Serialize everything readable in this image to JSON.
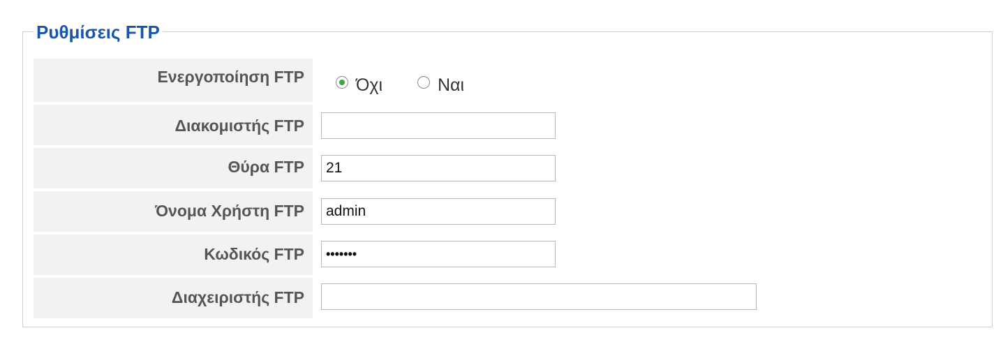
{
  "section": {
    "title": "Ρυθμίσεις FTP"
  },
  "ftp_enable": {
    "label": "Ενεργοποίηση FTP",
    "options": [
      "Όχι",
      "Ναι"
    ],
    "selected": "Όχι"
  },
  "ftp_server": {
    "label": "Διακομιστής FTP",
    "value": ""
  },
  "ftp_port": {
    "label": "Θύρα FTP",
    "value": "21"
  },
  "ftp_username": {
    "label": "Όνομα Χρήστη FTP",
    "value": "admin"
  },
  "ftp_password": {
    "label": "Κωδικός FTP",
    "value": "•••••••"
  },
  "ftp_manager": {
    "label": "Διαχειριστής FTP",
    "value": ""
  },
  "colors": {
    "accent": "#1a56a8",
    "radio_selected": "#3da644",
    "label_background": "#f2f2f2"
  }
}
